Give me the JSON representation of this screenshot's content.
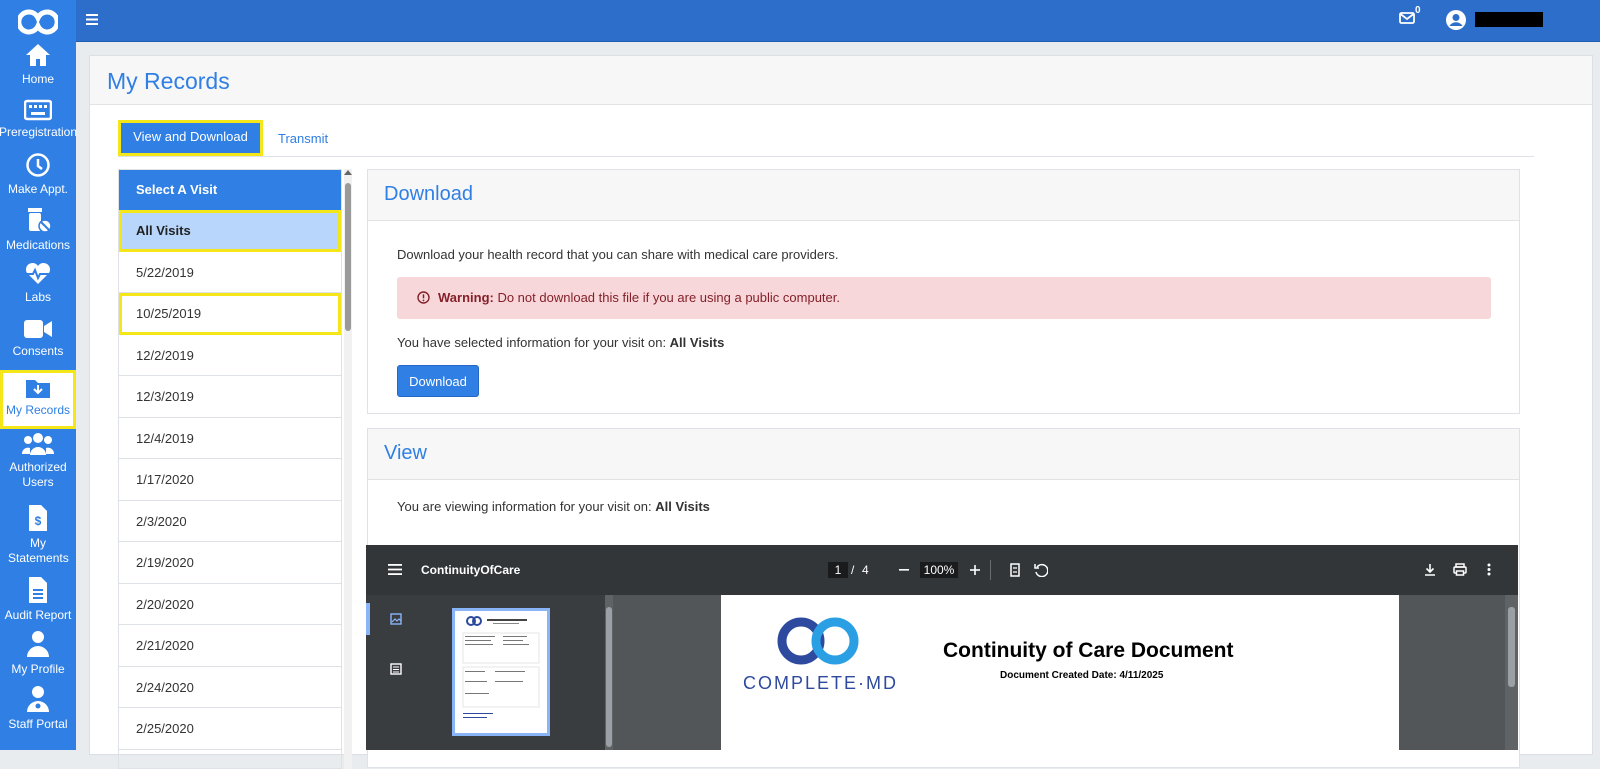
{
  "sidebar": {
    "items": [
      {
        "label": "Home",
        "icon": "home-icon"
      },
      {
        "label": "Preregistration",
        "icon": "keyboard-icon"
      },
      {
        "label": "Make Appt.",
        "icon": "clock-icon"
      },
      {
        "label": "Medications",
        "icon": "pills-icon"
      },
      {
        "label": "Labs",
        "icon": "heartbeat-icon"
      },
      {
        "label": "Consents",
        "icon": "video-icon"
      },
      {
        "label": "My Records",
        "icon": "folder-download-icon"
      },
      {
        "label": "Authorized Users",
        "icon": "users-icon"
      },
      {
        "label": "My Statements",
        "icon": "invoice-icon"
      },
      {
        "label": "Audit Report",
        "icon": "file-icon"
      },
      {
        "label": "My Profile",
        "icon": "user-icon"
      },
      {
        "label": "Staff Portal",
        "icon": "user-doctor-icon"
      }
    ]
  },
  "topbar": {
    "mail_count": "0"
  },
  "page": {
    "title": "My Records"
  },
  "tabs": {
    "view_download": "View and Download",
    "transmit": "Transmit"
  },
  "visits": {
    "header": "Select A Visit",
    "items": [
      "All Visits",
      "5/22/2019",
      "10/25/2019",
      "12/2/2019",
      "12/3/2019",
      "12/4/2019",
      "1/17/2020",
      "2/3/2020",
      "2/19/2020",
      "2/20/2020",
      "2/21/2020",
      "2/24/2020",
      "2/25/2020"
    ]
  },
  "download": {
    "title": "Download",
    "description": "Download your health record that you can share with medical care providers.",
    "warning_label": "Warning:",
    "warning_text": " Do not download this file if you are using a public computer.",
    "selected_prefix": "You have selected information for your visit on: ",
    "selected_value": "All Visits",
    "button": "Download"
  },
  "view": {
    "title": "View",
    "viewing_prefix": "You are viewing information for your visit on: ",
    "viewing_value": "All Visits"
  },
  "pdf": {
    "filename": "ContinuityOfCare",
    "page_current": "1",
    "page_sep": "/",
    "page_total": "4",
    "zoom": "100%",
    "doc_title": "Continuity of Care Document",
    "doc_date": "Document Created Date: 4/11/2025",
    "brand": "COMPLETE·MD"
  },
  "colors": {
    "primary": "#2f7fe4",
    "highlight": "#f5e61a",
    "warning_bg": "#f8d7da"
  }
}
